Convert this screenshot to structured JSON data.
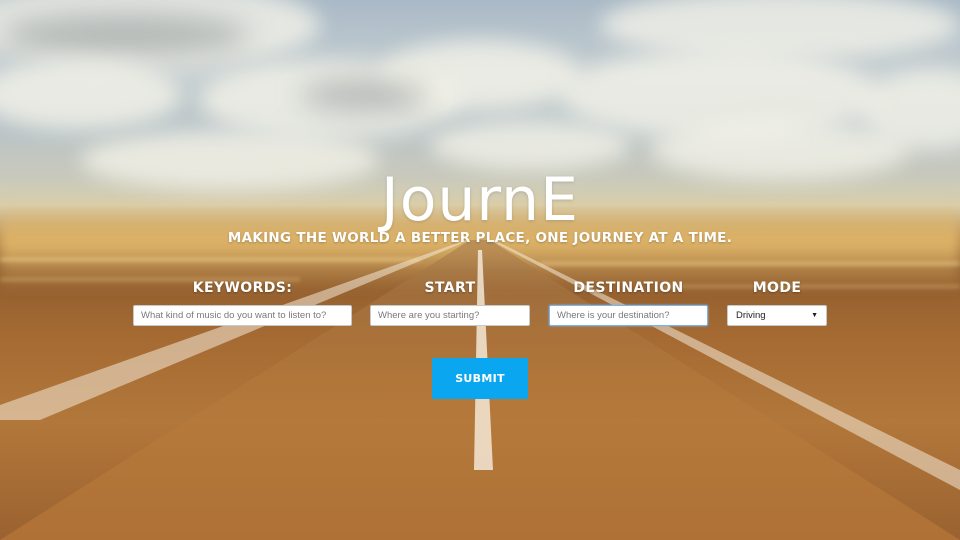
{
  "hero": {
    "logo": "JournE",
    "tagline": "MAKING THE WORLD A BETTER PLACE, ONE JOURNEY AT A TIME."
  },
  "form": {
    "keywords": {
      "label": "KEYWORDS:",
      "placeholder": "What kind of music do you want to listen to?",
      "value": ""
    },
    "start": {
      "label": "START",
      "placeholder": "Where are you starting?",
      "value": ""
    },
    "destination": {
      "label": "DESTINATION",
      "placeholder": "Where is your destination?",
      "value": ""
    },
    "mode": {
      "label": "MODE",
      "selected": "Driving",
      "arrow_icon": "dropdown-arrow-icon"
    },
    "submit_label": "SUBMIT"
  },
  "colors": {
    "submit_background": "#0aa6ef",
    "text": "#ffffff",
    "focus_ring": "#7fb3e6"
  }
}
